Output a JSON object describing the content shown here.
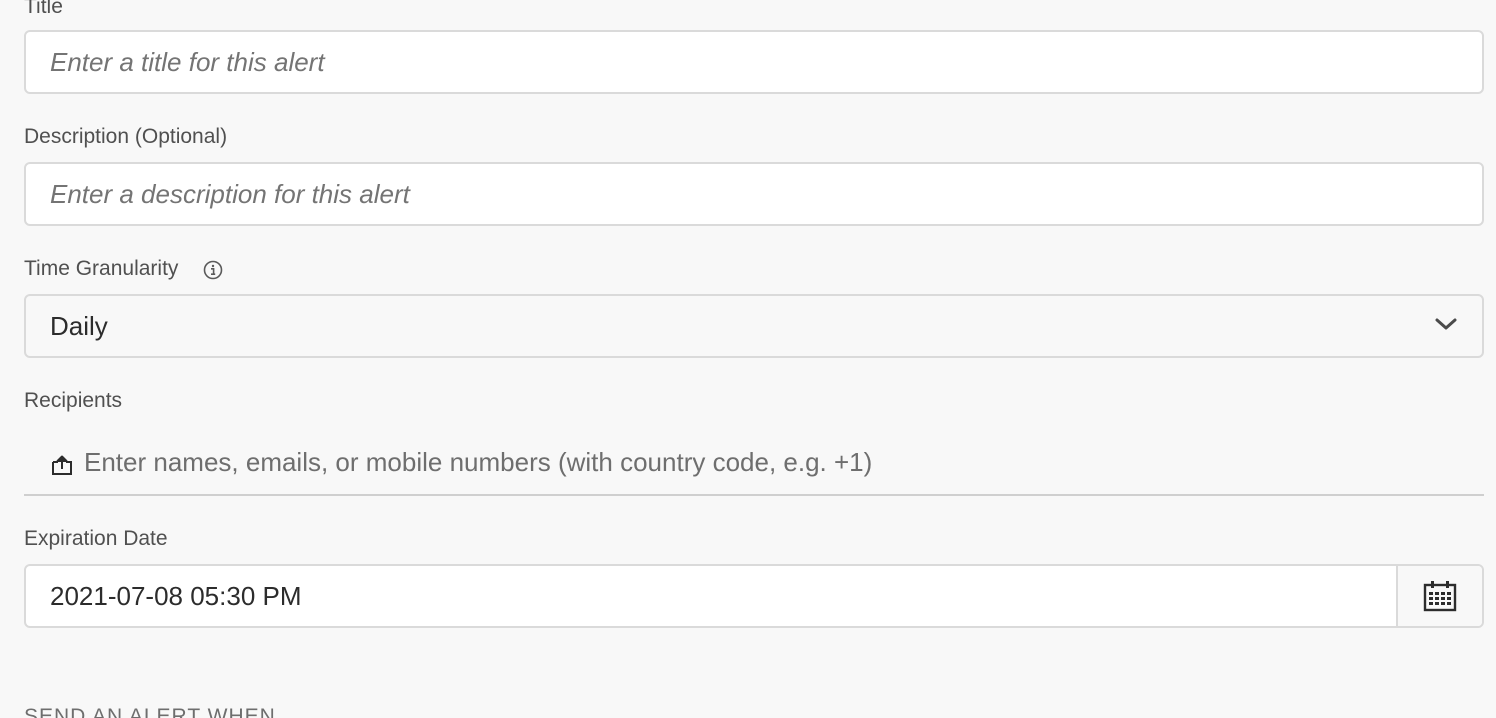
{
  "title_field": {
    "label": "Title",
    "placeholder": "Enter a title for this alert",
    "value": ""
  },
  "description_field": {
    "label": "Description (Optional)",
    "placeholder": "Enter a description for this alert",
    "value": ""
  },
  "time_granularity": {
    "label": "Time Granularity",
    "info_icon": "info-icon",
    "selected": "Daily",
    "dropdown_icon": "chevron-down-icon"
  },
  "recipients": {
    "label": "Recipients",
    "icon": "share-upload-icon",
    "placeholder": "Enter names, emails, or mobile numbers (with country code, e.g. +1)"
  },
  "expiration_date": {
    "label": "Expiration Date",
    "value": "2021-07-08 05:30 PM",
    "calendar_icon": "calendar-icon"
  },
  "section": {
    "heading": "SEND AN ALERT WHEN"
  },
  "colors": {
    "background": "#f8f8f8",
    "border": "#dadada",
    "text": "#4b4b4b"
  }
}
